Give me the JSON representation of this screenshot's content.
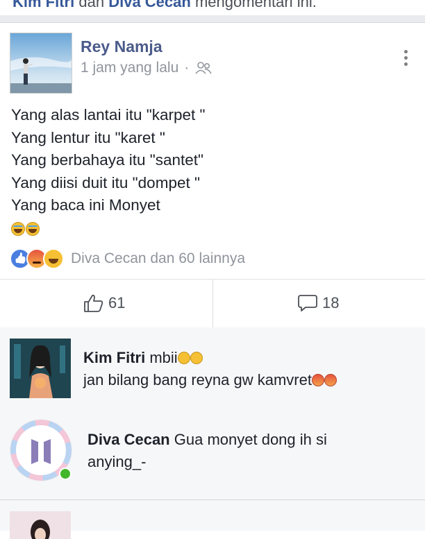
{
  "notice": {
    "name1": "Kim Fitri",
    "between": "dan",
    "name2": "Diva Cecan",
    "tail": "mengomentari ini."
  },
  "post": {
    "author": "Rey Namja",
    "time": "1 jam yang lalu",
    "separator": "·",
    "privacy_icon": "friends-icon",
    "lines": [
      "Yang alas lantai itu \"karpet \"",
      "Yang lentur itu \"karet \"",
      "Yang berbahaya itu \"santet\"",
      "Yang diisi duit itu \"dompet \"",
      "Yang baca ini Monyet"
    ],
    "emoji_icons": [
      "laughing-emoji-icon",
      "laughing-emoji-icon"
    ],
    "reaction_icons": [
      "like-reaction-icon",
      "angry-reaction-icon",
      "haha-reaction-icon"
    ],
    "reactions_text": "Diva Cecan dan 60 lainnya",
    "like_count": "61",
    "comment_count": "18"
  },
  "comments": [
    {
      "name": "Kim Fitri",
      "line1": "mbii",
      "line2": "jan bilang bang reyna gw kamvret"
    },
    {
      "name": "Diva Cecan",
      "line1": "Gua monyet dong ih si",
      "line2": "anying_-"
    }
  ],
  "colors": {
    "link": "#365899",
    "author": "#4b5b8a",
    "muted": "#90949c",
    "like_blue": "#4a7fe0",
    "online": "#42b72a"
  }
}
